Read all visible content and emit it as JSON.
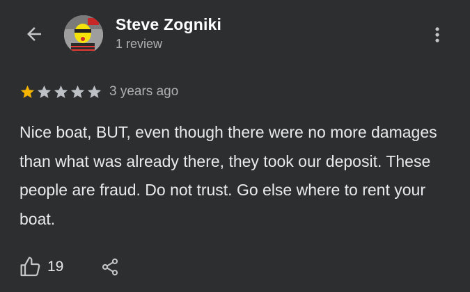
{
  "header": {
    "back_icon": "arrow-left-icon",
    "more_icon": "more-vert-icon"
  },
  "reviewer": {
    "name": "Steve Zogniki",
    "review_count_text": "1 review"
  },
  "review": {
    "rating": 1,
    "max_rating": 5,
    "date_text": "3 years ago",
    "body": "Nice boat, BUT, even though there were no more damages than what was already there, they took our deposit. These people are fraud. Do not trust. Go else where to rent your boat."
  },
  "actions": {
    "like_icon": "thumb-up-icon",
    "like_count": "19",
    "share_icon": "share-icon"
  },
  "colors": {
    "background": "#2d2e30",
    "star_filled": "#f4b400",
    "star_empty": "#bdc1c6",
    "text_primary": "#e8eaed",
    "text_secondary": "#aeb0b3"
  }
}
